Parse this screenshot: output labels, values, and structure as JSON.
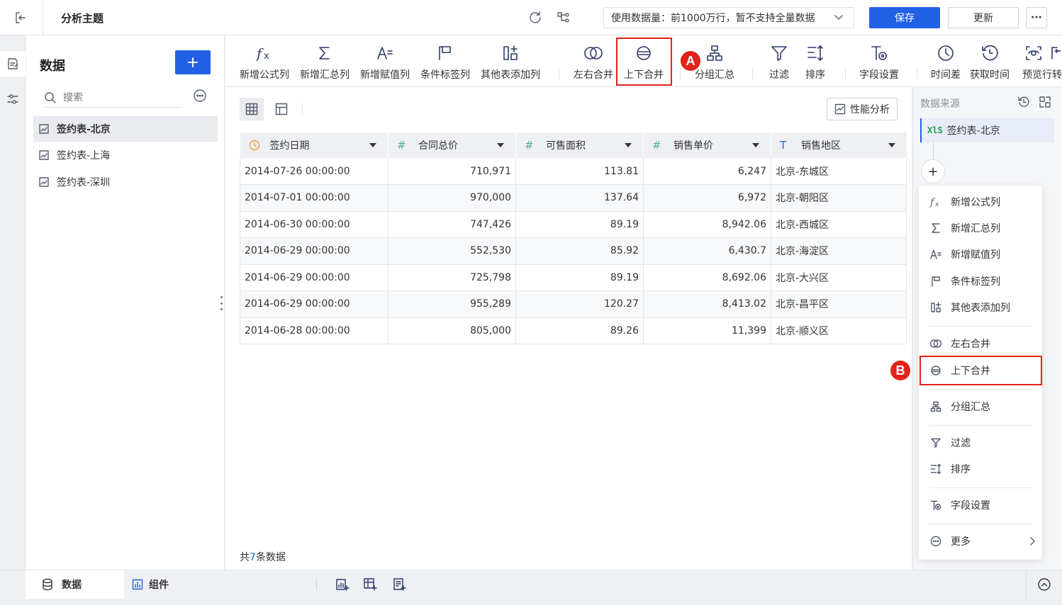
{
  "header": {
    "title": "分析主题",
    "data_usage": "使用数据量：前1000万行，暂不支持全量数据",
    "save_label": "保存",
    "update_label": "更新",
    "more_label": "···"
  },
  "data_panel": {
    "title": "数据",
    "add_label": "+",
    "search_placeholder": "搜索",
    "items": [
      {
        "label": "签约表-北京"
      },
      {
        "label": "签约表-上海"
      },
      {
        "label": "签约表-深圳"
      }
    ]
  },
  "toolbar": {
    "items": [
      {
        "label": "新增公式列",
        "icon": "fx-icon"
      },
      {
        "label": "新增汇总列",
        "icon": "sigma-icon"
      },
      {
        "label": "新增赋值列",
        "icon": "assign-icon"
      },
      {
        "label": "条件标签列",
        "icon": "flag-icon"
      },
      {
        "label": "其他表添加列",
        "icon": "add-column-icon"
      },
      {
        "label": "左右合并",
        "icon": "venn-icon"
      },
      {
        "label": "上下合并",
        "icon": "union-icon"
      },
      {
        "label": "分组汇总",
        "icon": "group-icon"
      },
      {
        "label": "过滤",
        "icon": "filter-icon"
      },
      {
        "label": "排序",
        "icon": "sort-icon"
      },
      {
        "label": "字段设置",
        "icon": "field-settings-icon"
      },
      {
        "label": "时间差",
        "icon": "clock-icon"
      },
      {
        "label": "获取时间",
        "icon": "history-icon"
      },
      {
        "label": "预览行转",
        "icon": "preview-icon"
      }
    ]
  },
  "annotations": {
    "a": "A",
    "b": "B"
  },
  "view": {
    "perf_label": "性能分析"
  },
  "table": {
    "columns": [
      {
        "label": "签约日期",
        "type_icon": "◷"
      },
      {
        "label": "合同总价",
        "type_icon": "#"
      },
      {
        "label": "可售面积",
        "type_icon": "#"
      },
      {
        "label": "销售单价",
        "type_icon": "#"
      },
      {
        "label": "销售地区",
        "type_icon": "T"
      }
    ],
    "rows": [
      [
        "2014-07-26 00:00:00",
        "710,971",
        "113.81",
        "6,247",
        "北京-东城区"
      ],
      [
        "2014-07-01 00:00:00",
        "970,000",
        "137.64",
        "6,972",
        "北京-朝阳区"
      ],
      [
        "2014-06-30 00:00:00",
        "747,426",
        "89.19",
        "8,942.06",
        "北京-西城区"
      ],
      [
        "2014-06-29 00:00:00",
        "552,530",
        "85.92",
        "6,430.7",
        "北京-海淀区"
      ],
      [
        "2014-06-29 00:00:00",
        "725,798",
        "89.19",
        "8,692.06",
        "北京-大兴区"
      ],
      [
        "2014-06-29 00:00:00",
        "955,289",
        "120.27",
        "8,413.02",
        "北京-昌平区"
      ],
      [
        "2014-06-28 00:00:00",
        "805,000",
        "89.26",
        "11,399",
        "北京-顺义区"
      ]
    ],
    "footer_prefix": "共",
    "footer_count": "7",
    "footer_suffix": "条数据"
  },
  "right_panel": {
    "title": "数据来源",
    "source_label": "签约表-北京",
    "xls_badge": "XlS",
    "add_label": "+"
  },
  "menu": {
    "items": [
      {
        "label": "新增公式列"
      },
      {
        "label": "新增汇总列"
      },
      {
        "label": "新增赋值列"
      },
      {
        "label": "条件标签列"
      },
      {
        "label": "其他表添加列"
      },
      {
        "label": "左右合并"
      },
      {
        "label": "上下合并"
      },
      {
        "label": "分组汇总"
      },
      {
        "label": "过滤"
      },
      {
        "label": "排序"
      },
      {
        "label": "字段设置"
      },
      {
        "label": "更多"
      }
    ]
  },
  "bottom": {
    "data_tab": "数据",
    "component_tab": "组件"
  },
  "colors": {
    "primary": "#2161e6",
    "highlight": "#e2231a",
    "field_number": "#52b39a",
    "field_date": "#f0a03c"
  }
}
